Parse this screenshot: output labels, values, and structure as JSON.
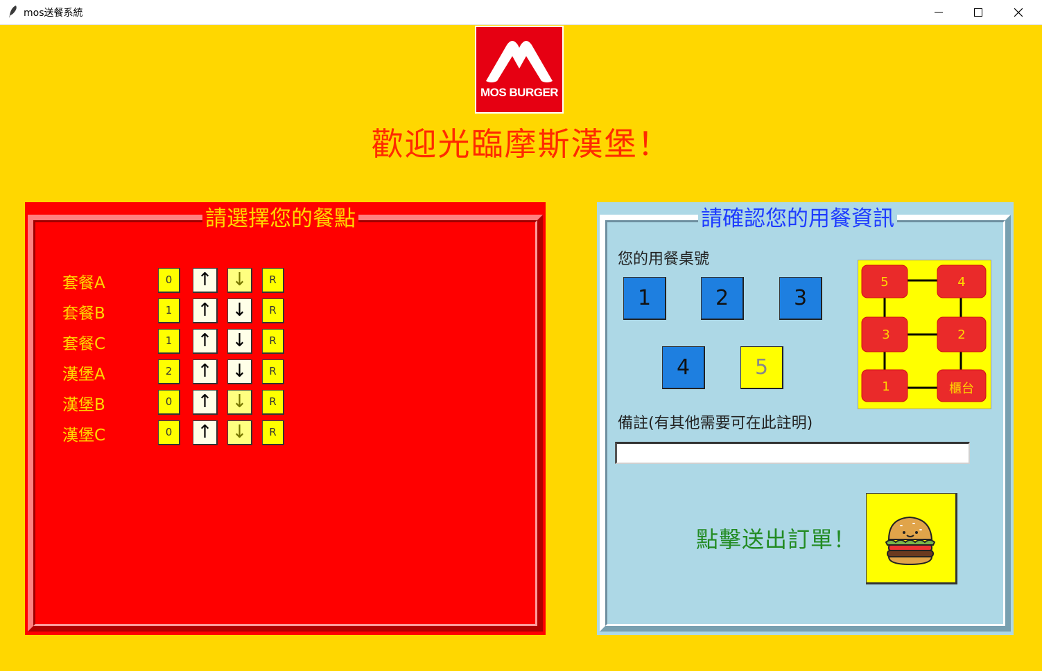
{
  "window": {
    "title": "mos送餐系統",
    "icon": "feather-icon",
    "controls": [
      "minimize-icon",
      "maximize-icon",
      "close-icon"
    ]
  },
  "header": {
    "logo_text": "MOS BURGER",
    "welcome": "歡迎光臨摩斯漢堡！"
  },
  "menu_panel": {
    "title": "請選擇您的餐點",
    "items": [
      {
        "label": "套餐A",
        "count": "0",
        "up": "↑",
        "down": "↓",
        "reset": "R"
      },
      {
        "label": "套餐B",
        "count": "1",
        "up": "↑",
        "down": "↓",
        "reset": "R"
      },
      {
        "label": "套餐C",
        "count": "1",
        "up": "↑",
        "down": "↓",
        "reset": "R"
      },
      {
        "label": "漢堡A",
        "count": "2",
        "up": "↑",
        "down": "↓",
        "reset": "R"
      },
      {
        "label": "漢堡B",
        "count": "0",
        "up": "↑",
        "down": "↓",
        "reset": "R"
      },
      {
        "label": "漢堡C",
        "count": "0",
        "up": "↑",
        "down": "↓",
        "reset": "R"
      }
    ]
  },
  "info_panel": {
    "title": "請確認您的用餐資訊",
    "table_label": "您的用餐桌號",
    "tables": [
      "1",
      "2",
      "3",
      "4",
      "5"
    ],
    "selected_table": "5",
    "map": {
      "nodes": [
        "5",
        "4",
        "3",
        "2",
        "1",
        "櫃台"
      ]
    },
    "note_label": "備註(有其他需要可在此註明)",
    "note_value": "",
    "submit_label": "點擊送出訂單！",
    "submit_icon": "burger-icon"
  },
  "colors": {
    "background": "#FFD700",
    "menu_panel": "#FF0000",
    "info_panel": "#ADD8E6",
    "table_button": "#1E7FE0",
    "selected_table": "#FFFF00",
    "welcome_text": "#FF2A00",
    "info_title": "#1E3CFF",
    "submit_text": "#228B22"
  }
}
